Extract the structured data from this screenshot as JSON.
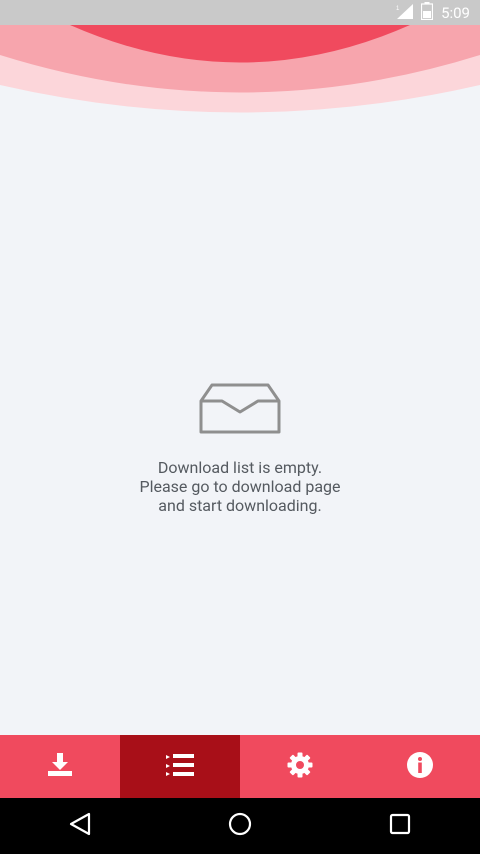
{
  "status_bar": {
    "time": "5:09",
    "icons": [
      "signal-icon",
      "battery-icon"
    ]
  },
  "colors": {
    "accent": "#f04a5e",
    "accent_active": "#a80f18",
    "background": "#f2f4f8"
  },
  "empty_state": {
    "icon": "inbox-tray-icon",
    "lines": [
      "Download list is empty.",
      "Please go to download page",
      "and start downloading."
    ]
  },
  "bottom_nav": {
    "active_index": 1,
    "tabs": [
      {
        "icon": "download-icon"
      },
      {
        "icon": "list-icon"
      },
      {
        "icon": "gear-icon"
      },
      {
        "icon": "info-icon"
      }
    ]
  },
  "system_nav": {
    "buttons": [
      "back-icon",
      "home-icon",
      "recents-icon"
    ]
  }
}
